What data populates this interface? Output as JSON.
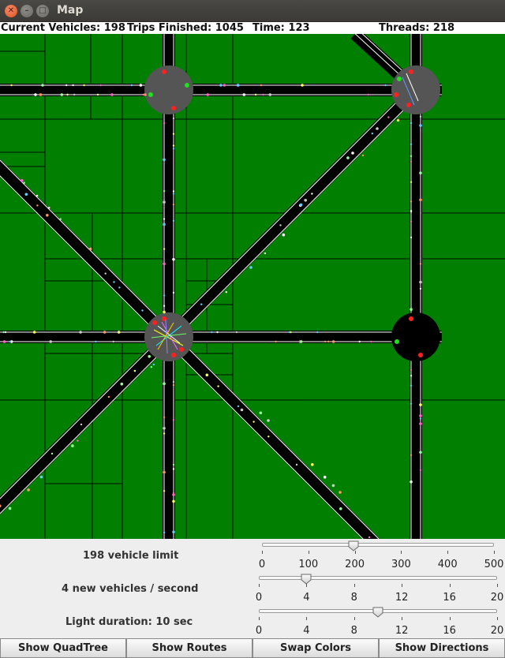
{
  "window": {
    "title": "Map"
  },
  "status": {
    "vehicles": "Current Vehicles: 198",
    "trips": "Trips Finished: 1045",
    "time": "Time: 123",
    "threads": "Threads: 218"
  },
  "colors": {
    "grass": "#007f00",
    "road": "#000000",
    "lane_line": "#ffffff",
    "intersection": "#555555",
    "light_red": "#ff2020",
    "light_green": "#20e020"
  },
  "controls": {
    "vehicle_limit": {
      "label": "198 vehicle limit",
      "value": 198,
      "min": 0,
      "max": 500,
      "ticks": [
        "0",
        "100",
        "200",
        "300",
        "400",
        "500"
      ]
    },
    "spawn_rate": {
      "label": "4 new vehicles / second",
      "value": 4,
      "min": 0,
      "max": 20,
      "ticks": [
        "0",
        "4",
        "8",
        "12",
        "16",
        "20"
      ]
    },
    "light_duration": {
      "label": "Light duration: 10 sec",
      "value": 10,
      "min": 0,
      "max": 20,
      "ticks": [
        "0",
        "4",
        "8",
        "12",
        "16",
        "20"
      ]
    }
  },
  "buttons": {
    "quadtree": "Show QuadTree",
    "routes": "Show Routes",
    "colors": "Swap Colors",
    "directions": "Show Directions"
  }
}
